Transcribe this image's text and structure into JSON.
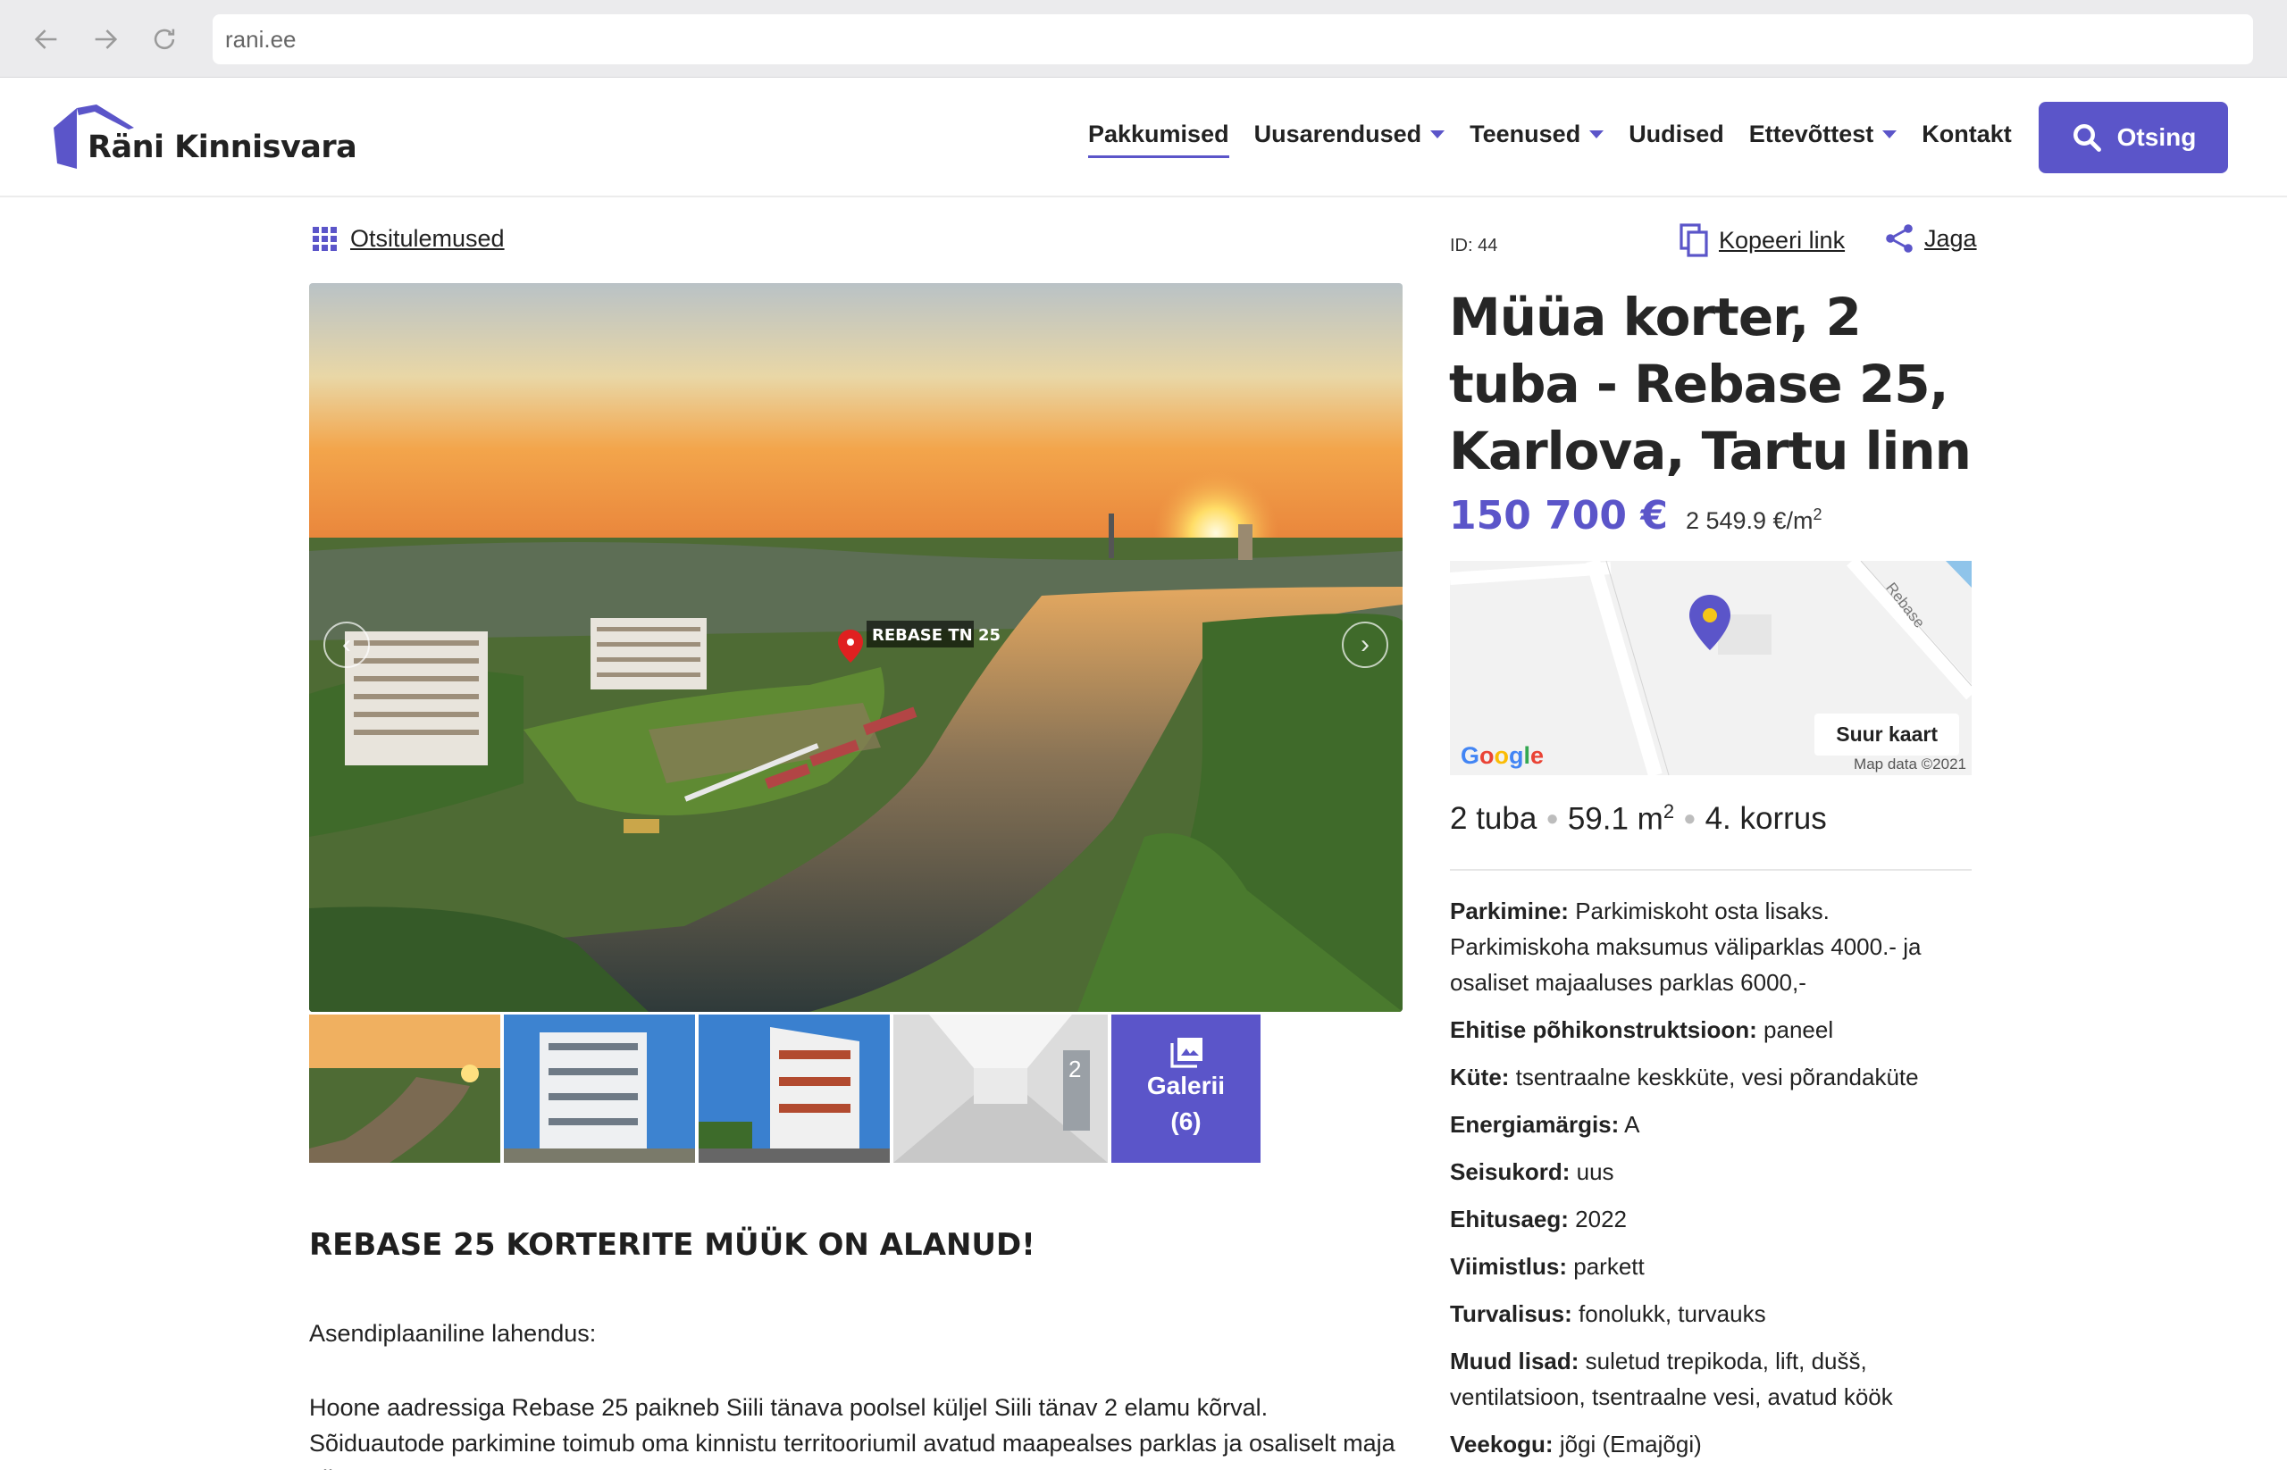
{
  "browser": {
    "url": "rani.ee"
  },
  "header": {
    "logo_text": "Räni Kinnisvara",
    "nav": [
      {
        "label": "Pakkumised",
        "active": true,
        "dropdown": false
      },
      {
        "label": "Uusarendused",
        "active": false,
        "dropdown": true
      },
      {
        "label": "Teenused",
        "active": false,
        "dropdown": true
      },
      {
        "label": "Uudised",
        "active": false,
        "dropdown": false
      },
      {
        "label": "Ettevõttest",
        "active": false,
        "dropdown": true
      },
      {
        "label": "Kontakt",
        "active": false,
        "dropdown": false
      }
    ],
    "search_label": "Otsing"
  },
  "toolbar": {
    "back_label": "Otsitulemused",
    "id_label": "ID: 44",
    "copy_label": "Kopeeri link",
    "share_label": "Jaga"
  },
  "gallery": {
    "hero_marker_label": "REBASE TN 25",
    "thumb_overlay": "2",
    "gallery_label": "Galerii",
    "gallery_count": "(6)"
  },
  "listing": {
    "title": "Müüa korter, 2 tuba - Rebase 25, Karlova, Tartu linn",
    "price": "150 700 €",
    "price_per_sqm": "2 549.9 €/m",
    "price_per_sqm_sup": "2",
    "rooms": "2 tuba",
    "area": "59.1 m",
    "area_sup": "2",
    "floor": "4. korrus"
  },
  "map": {
    "button_label": "Suur kaart",
    "google_label": "Google",
    "map_data": "Map data ©2021",
    "street_label": "Rebase"
  },
  "details": [
    {
      "label": "Parkimine:",
      "value": "Parkimiskoht osta lisaks. Parkimiskoha maksumus väliparklas 4000.- ja osaliset majaaluses parklas 6000,-"
    },
    {
      "label": "Ehitise põhikonstruktsioon:",
      "value": "paneel"
    },
    {
      "label": "Küte:",
      "value": "tsentraalne keskküte, vesi põrandaküte"
    },
    {
      "label": "Energiamärgis:",
      "value": "A"
    },
    {
      "label": "Seisukord:",
      "value": "uus"
    },
    {
      "label": "Ehitusaeg:",
      "value": "2022"
    },
    {
      "label": "Viimistlus:",
      "value": "parkett"
    },
    {
      "label": "Turvalisus:",
      "value": "fonolukk, turvauks"
    },
    {
      "label": "Muud lisad:",
      "value": "suletud trepikoda, lift, dušš, ventilatsioon, tsentraalne vesi, avatud köök"
    },
    {
      "label": "Veekogu:",
      "value": "jõgi (Emajõgi)"
    }
  ],
  "description": {
    "heading": "REBASE 25 KORTERITE MÜÜK ON ALANUD!",
    "subheading": "Asendiplaaniline lahendus:",
    "body": "Hoone aadressiga Rebase 25 paikneb Siili tänava poolsel küljel Siili tänav 2 elamu kõrval. Sõiduautode parkimine toimub oma kinnistu territooriumil avatud maapealses parklas ja osaliselt maja all"
  },
  "colors": {
    "accent": "#5b55c9"
  }
}
